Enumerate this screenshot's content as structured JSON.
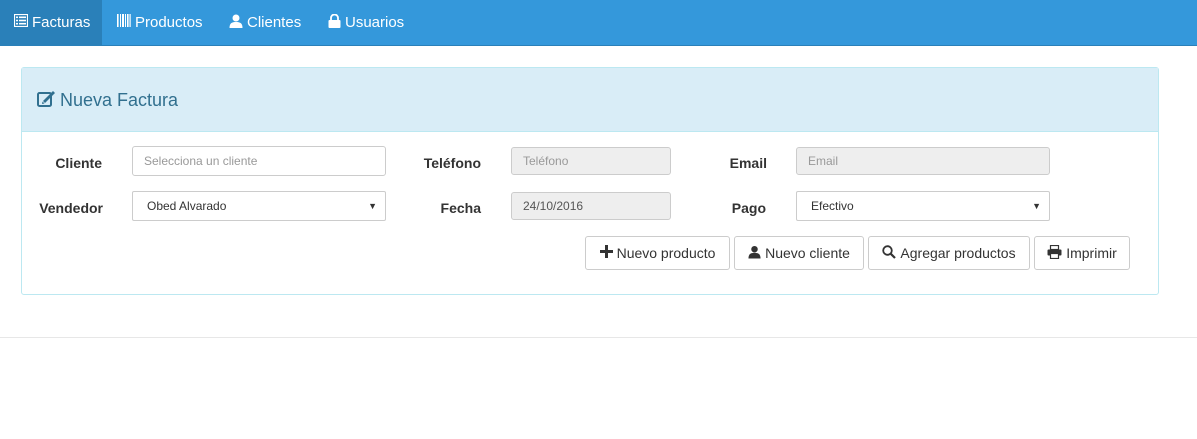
{
  "navbar": {
    "items": [
      {
        "label": "Facturas",
        "icon": "list-icon",
        "active": true
      },
      {
        "label": "Productos",
        "icon": "barcode-icon",
        "active": false
      },
      {
        "label": "Clientes",
        "icon": "user-icon",
        "active": false
      },
      {
        "label": "Usuarios",
        "icon": "lock-icon",
        "active": false
      }
    ]
  },
  "panel": {
    "title": "Nueva Factura",
    "title_icon": "edit-icon"
  },
  "form": {
    "cliente_label": "Cliente",
    "cliente_placeholder": "Selecciona un cliente",
    "telefono_label": "Teléfono",
    "telefono_placeholder": "Teléfono",
    "email_label": "Email",
    "email_placeholder": "Email",
    "vendedor_label": "Vendedor",
    "vendedor_value": "Obed Alvarado",
    "fecha_label": "Fecha",
    "fecha_value": "24/10/2016",
    "pago_label": "Pago",
    "pago_value": "Efectivo"
  },
  "actions": {
    "nuevo_producto": "Nuevo producto",
    "nuevo_cliente": "Nuevo cliente",
    "agregar_productos": "Agregar productos",
    "imprimir": "Imprimir"
  },
  "colors": {
    "navbar": "#3498db",
    "navbar_active": "#2a80b9",
    "panel_heading": "#d9edf7",
    "panel_title": "#31708f"
  }
}
